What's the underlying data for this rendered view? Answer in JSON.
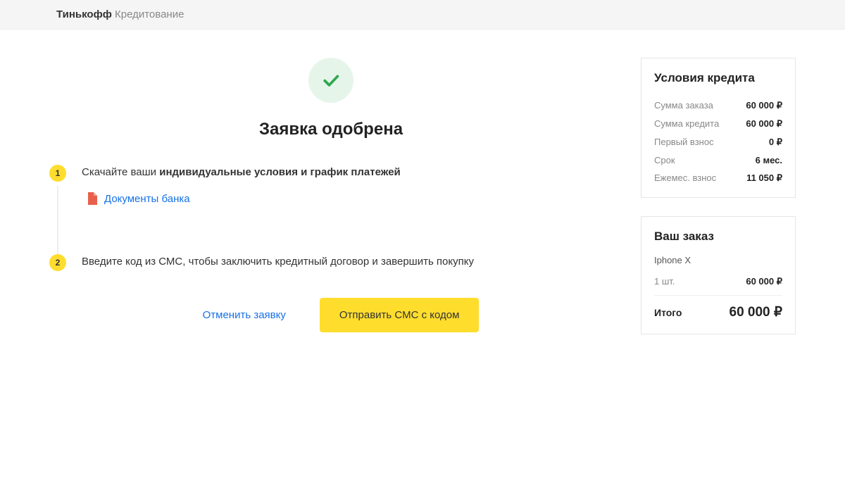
{
  "header": {
    "brand_bold": "Тинькофф",
    "brand_light": " Кредитование"
  },
  "main": {
    "title": "Заявка одобрена",
    "step1": {
      "num": "1",
      "text_pre": "Скачайте ваши ",
      "text_bold": "индивидуальные условия и график платежей",
      "doc_link": "Документы банка"
    },
    "step2": {
      "num": "2",
      "text": "Введите код из СМС, чтобы заключить кредитный договор и завершить покупку"
    },
    "actions": {
      "cancel": "Отменить заявку",
      "send_sms": "Отправить СМС с кодом"
    }
  },
  "credit": {
    "title": "Условия кредита",
    "rows": {
      "order_sum_label": "Сумма заказа",
      "order_sum_value": "60 000 ₽",
      "credit_sum_label": "Сумма кредита",
      "credit_sum_value": "60 000 ₽",
      "down_label": "Первый взнос",
      "down_value": "0 ₽",
      "term_label": "Срок",
      "term_value": "6 мес.",
      "monthly_label": "Ежемес. взнос",
      "monthly_value": "11 050 ₽"
    }
  },
  "order": {
    "title": "Ваш заказ",
    "item_name": "Iphone X",
    "qty_label": "1 шт.",
    "qty_value": "60 000 ₽",
    "total_label": "Итого",
    "total_value": "60 000 ₽"
  }
}
